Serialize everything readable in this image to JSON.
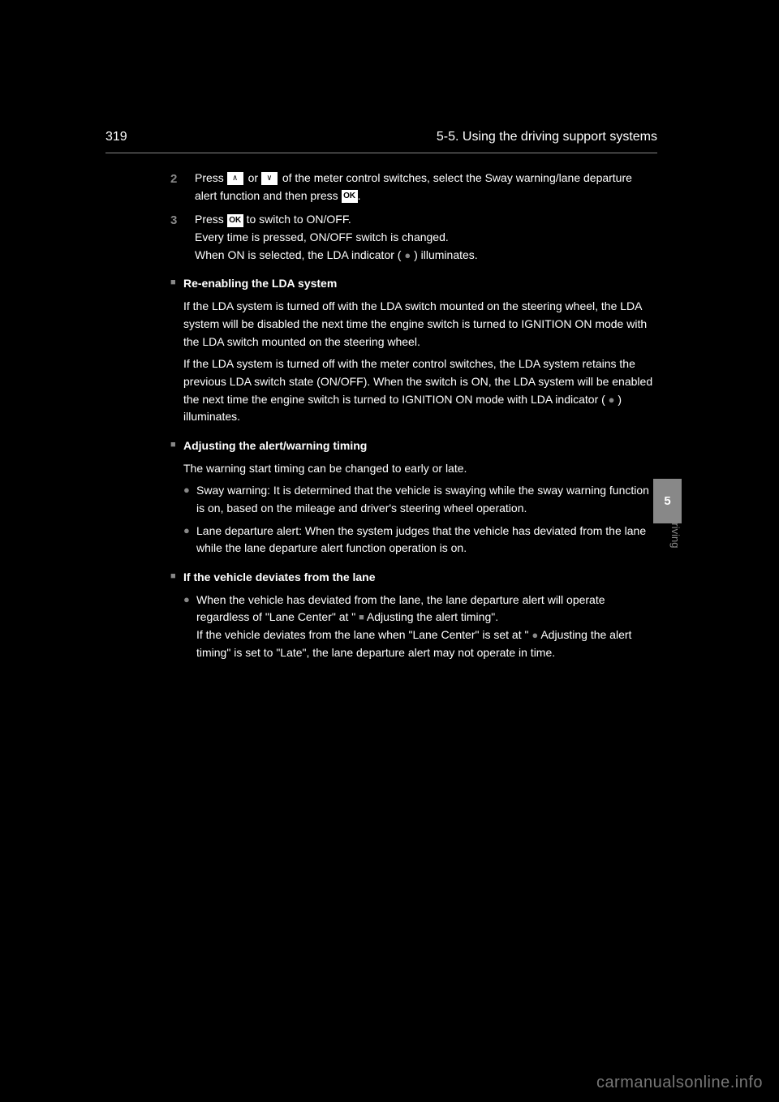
{
  "header": {
    "page_num": "319",
    "section": "5-5. Using the driving support systems"
  },
  "sidebar": {
    "chapter": "5",
    "label": "Driving"
  },
  "step2": {
    "num": "2",
    "text_before": "Press ",
    "text_mid": " or ",
    "text_after": " of the meter control switches, select the Sway warning/lane departure alert function and then press ",
    "period": "."
  },
  "step3": {
    "num": "3",
    "text_before": "Press ",
    "text_after": " to switch to ON/OFF."
  },
  "step3_sub": "Every time   is pressed, ON/OFF switch is changed.",
  "step3_note_before": "When ON is selected, the LDA indicator (",
  "step3_note_after": ") illuminates.",
  "head1": "Re-enabling the LDA system",
  "para1": "If the LDA system is turned off with the LDA switch mounted on the steering wheel, the LDA system will be disabled the next time the engine switch is turned to IGNITION ON mode with the LDA switch mounted on the steering wheel.",
  "para2_before": "If the LDA system is turned off with the meter control switches, the LDA system retains the previous LDA switch state (ON/OFF). When the switch is ON, the LDA system will be enabled the next time the engine switch is turned to IGNITION ON mode with LDA indicator (",
  "para2_after": ") illuminates.",
  "head2": "Adjusting the alert/warning timing",
  "para3": "The warning start timing can be changed to early or late.",
  "bullet1": "Sway warning: It is determined that the vehicle is swaying while the sway warning function is on, based on the mileage and driver's steering wheel operation.",
  "bullet2": "Lane departure alert: When the system judges that the vehicle has deviated from the lane while the lane departure alert function operation is on.",
  "head3": "If the vehicle deviates from the lane",
  "bullet3_before": "When the vehicle has deviated from the lane, the lane departure alert will operate regardless of \"Lane Center\" at \"",
  "bullet3_mid": "Adjusting the alert timing\".",
  "bullet3_after": "If the vehicle deviates from the lane when \"Lane Center\" is set at \"",
  "bullet3_end": "Adjusting the alert timing\" is set to \"Late\", the lane departure alert may not operate in time.",
  "watermark": "carmanualsonline.info",
  "ok_label": "OK"
}
